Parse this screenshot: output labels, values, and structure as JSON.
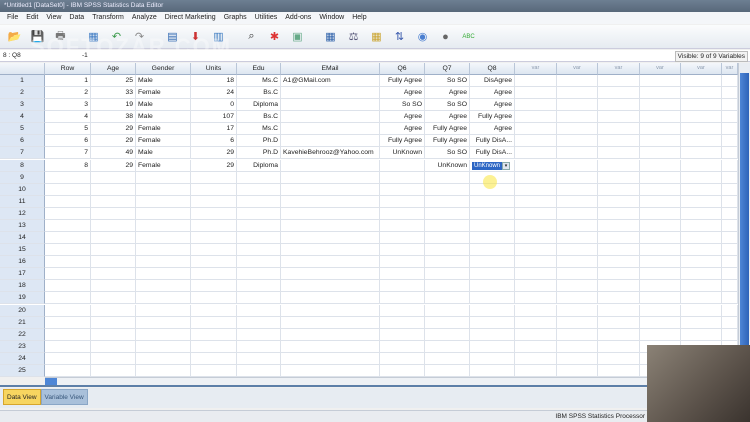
{
  "window": {
    "title": "*Untitled1 [DataSet0] - IBM SPSS Statistics Data Editor"
  },
  "menu": [
    "File",
    "Edit",
    "View",
    "Data",
    "Transform",
    "Analyze",
    "Direct Marketing",
    "Graphs",
    "Utilities",
    "Add-ons",
    "Window",
    "Help"
  ],
  "toolbar": [
    {
      "name": "open-icon",
      "glyph": "📂"
    },
    {
      "name": "save-icon",
      "glyph": "💾"
    },
    {
      "name": "print-icon",
      "glyph": "🖶"
    },
    {
      "name": "recall-dialog-icon",
      "glyph": "▦"
    },
    {
      "name": "undo-icon",
      "glyph": "↶"
    },
    {
      "name": "redo-icon",
      "glyph": "↷"
    },
    {
      "name": "goto-case-icon",
      "glyph": "▤"
    },
    {
      "name": "goto-variable-icon",
      "glyph": "⬇"
    },
    {
      "name": "variables-icon",
      "glyph": "▥"
    },
    {
      "name": "find-icon",
      "glyph": "⌕"
    },
    {
      "name": "insert-cases-icon",
      "glyph": "✱"
    },
    {
      "name": "insert-variable-icon",
      "glyph": "▣"
    },
    {
      "name": "split-file-icon",
      "glyph": "▦"
    },
    {
      "name": "weight-cases-icon",
      "glyph": "⚖"
    },
    {
      "name": "select-cases-icon",
      "glyph": "▦"
    },
    {
      "name": "value-labels-icon",
      "glyph": "⇅"
    },
    {
      "name": "use-sets-icon",
      "glyph": "◉"
    },
    {
      "name": "show-all-variables-icon",
      "glyph": "●"
    },
    {
      "name": "spell-check-icon",
      "glyph": "ABC"
    }
  ],
  "editbar": {
    "cell_ref": "8 : Q8",
    "cell_value": "-1",
    "visible": "Visible: 9 of 9 Variables"
  },
  "watermark": "SOFTOZAR.COM",
  "grid": {
    "columns": [
      "Row",
      "Age",
      "Gender",
      "Units",
      "Edu",
      "EMail",
      "Q6",
      "Q7",
      "Q8",
      "var",
      "var",
      "var",
      "var",
      "var",
      "var"
    ],
    "rows": [
      [
        "1",
        "25",
        "Male",
        "18",
        "Ms.C",
        "A1@GMail.com",
        "Fully Agree",
        "So SO",
        "DisAgree"
      ],
      [
        "2",
        "33",
        "Female",
        "24",
        "Bs.C",
        "",
        "Agree",
        "Agree",
        "Agree"
      ],
      [
        "3",
        "19",
        "Male",
        "0",
        "Diploma",
        "",
        "So SO",
        "So SO",
        "Agree"
      ],
      [
        "4",
        "38",
        "Male",
        "107",
        "Bs.C",
        "",
        "Agree",
        "Agree",
        "Fully Agree"
      ],
      [
        "5",
        "29",
        "Female",
        "17",
        "Ms.C",
        "",
        "Agree",
        "Fully Agree",
        "Agree"
      ],
      [
        "6",
        "29",
        "Female",
        "6",
        "Ph.D",
        "",
        "Fully Agree",
        "Fully Agree",
        "Fully DisA..."
      ],
      [
        "7",
        "49",
        "Male",
        "29",
        "Ph.D",
        "KavehieBehrooz@Yahoo.com",
        "UnKnown",
        "So SO",
        "Fully DisA..."
      ],
      [
        "8",
        "29",
        "Female",
        "29",
        "Diploma",
        "",
        "",
        "UnKnown",
        "UnKnown"
      ]
    ],
    "row_count": 25,
    "selected": {
      "row": 8,
      "column": "Q8",
      "edit_text": "UnKnown"
    }
  },
  "tabs": {
    "data_view": "Data View",
    "variable_view": "Variable View"
  },
  "status": "IBM SPSS Statistics Processor"
}
